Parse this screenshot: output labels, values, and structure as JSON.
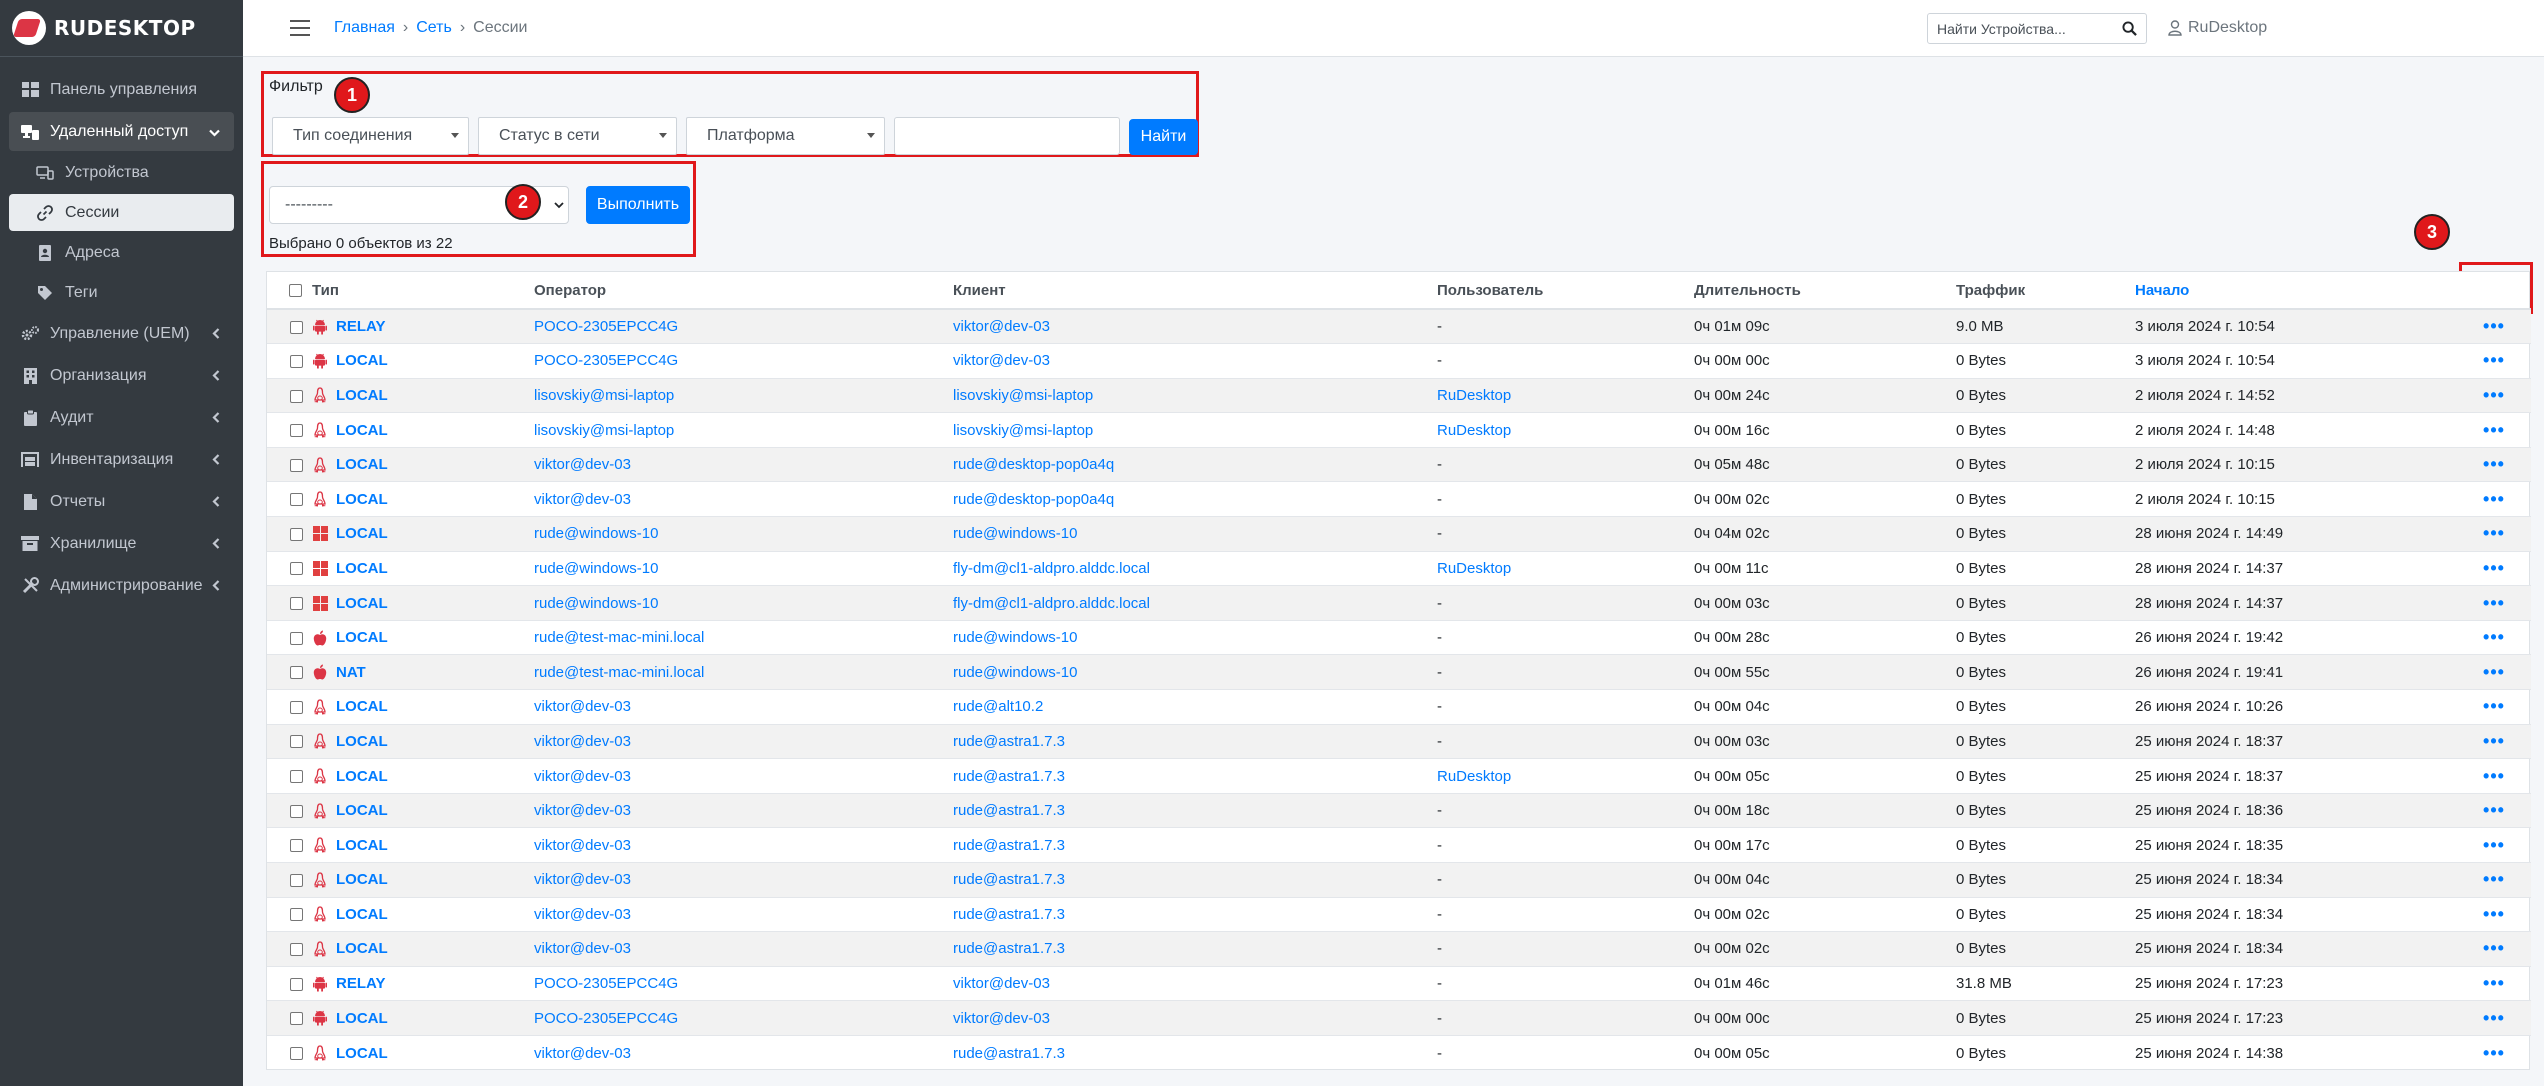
{
  "brand": {
    "name": "RUDESKTOP"
  },
  "sidebar": {
    "items": [
      {
        "label": "Панель управления",
        "icon": "dashboard-icon"
      },
      {
        "label": "Удаленный доступ",
        "icon": "remote-access-icon",
        "open": true
      },
      {
        "label": "Устройства",
        "icon": "devices-icon",
        "sub": true
      },
      {
        "label": "Сессии",
        "icon": "link-icon",
        "sub": true,
        "active": true
      },
      {
        "label": "Адреса",
        "icon": "address-book-icon",
        "sub": true
      },
      {
        "label": "Теги",
        "icon": "tag-icon",
        "sub": true
      },
      {
        "label": "Управление (UEM)",
        "icon": "gears-icon",
        "chevron": true
      },
      {
        "label": "Организация",
        "icon": "building-icon",
        "chevron": true
      },
      {
        "label": "Аудит",
        "icon": "clipboard-icon",
        "chevron": true
      },
      {
        "label": "Инвентаризация",
        "icon": "inventory-icon",
        "chevron": true
      },
      {
        "label": "Отчеты",
        "icon": "document-icon",
        "chevron": true
      },
      {
        "label": "Хранилище",
        "icon": "box-icon",
        "chevron": true
      },
      {
        "label": "Администрирование",
        "icon": "tools-icon",
        "chevron": true
      }
    ]
  },
  "breadcrumb": {
    "home": "Главная",
    "network": "Сеть",
    "current": "Сессии"
  },
  "search": {
    "placeholder": "Найти Устройства..."
  },
  "user": {
    "name": "RuDesktop"
  },
  "filter": {
    "label": "Фильтр",
    "connection_type": "Тип соединения",
    "online_status": "Статус в сети",
    "platform": "Платформа",
    "text_value": "",
    "find_button": "Найти"
  },
  "actions": {
    "select_value": "---------",
    "execute_button": "Выполнить",
    "selected_text": "Выбрано 0 объектов из 22"
  },
  "badges": {
    "one": "1",
    "two": "2",
    "three": "3"
  },
  "colors": {
    "accent": "#007bff",
    "annotation_red": "#e0181b",
    "android": "#dc3545",
    "windows": "#e04040",
    "linux": "#dc3545"
  },
  "table": {
    "headers": {
      "type": "Тип",
      "operator": "Оператор",
      "client": "Клиент",
      "user": "Пользователь",
      "duration": "Длительность",
      "traffic": "Траффик",
      "start": "Начало"
    },
    "rows": [
      {
        "os": "android",
        "type": "RELAY",
        "operator": "POCO-2305EPCC4G",
        "client": "viktor@dev-03",
        "user": "-",
        "duration": "0ч 01м 09с",
        "traffic": "9.0 MB",
        "start": "3 июля 2024 г. 10:54"
      },
      {
        "os": "android",
        "type": "LOCAL",
        "operator": "POCO-2305EPCC4G",
        "client": "viktor@dev-03",
        "user": "-",
        "duration": "0ч 00м 00с",
        "traffic": "0 Bytes",
        "start": "3 июля 2024 г. 10:54"
      },
      {
        "os": "linux",
        "type": "LOCAL",
        "operator": "lisovskiy@msi-laptop",
        "client": "lisovskiy@msi-laptop",
        "user": "RuDesktop",
        "duration": "0ч 00м 24с",
        "traffic": "0 Bytes",
        "start": "2 июля 2024 г. 14:52"
      },
      {
        "os": "linux",
        "type": "LOCAL",
        "operator": "lisovskiy@msi-laptop",
        "client": "lisovskiy@msi-laptop",
        "user": "RuDesktop",
        "duration": "0ч 00м 16с",
        "traffic": "0 Bytes",
        "start": "2 июля 2024 г. 14:48"
      },
      {
        "os": "linux",
        "type": "LOCAL",
        "operator": "viktor@dev-03",
        "client": "rude@desktop-pop0a4q",
        "user": "-",
        "duration": "0ч 05м 48с",
        "traffic": "0 Bytes",
        "start": "2 июля 2024 г. 10:15"
      },
      {
        "os": "linux",
        "type": "LOCAL",
        "operator": "viktor@dev-03",
        "client": "rude@desktop-pop0a4q",
        "user": "-",
        "duration": "0ч 00м 02с",
        "traffic": "0 Bytes",
        "start": "2 июля 2024 г. 10:15"
      },
      {
        "os": "windows",
        "type": "LOCAL",
        "operator": "rude@windows-10",
        "client": "rude@windows-10",
        "user": "-",
        "duration": "0ч 04м 02с",
        "traffic": "0 Bytes",
        "start": "28 июня 2024 г. 14:49"
      },
      {
        "os": "windows",
        "type": "LOCAL",
        "operator": "rude@windows-10",
        "client": "fly-dm@cl1-aldpro.alddc.local",
        "user": "RuDesktop",
        "duration": "0ч 00м 11с",
        "traffic": "0 Bytes",
        "start": "28 июня 2024 г. 14:37"
      },
      {
        "os": "windows",
        "type": "LOCAL",
        "operator": "rude@windows-10",
        "client": "fly-dm@cl1-aldpro.alddc.local",
        "user": "-",
        "duration": "0ч 00м 03с",
        "traffic": "0 Bytes",
        "start": "28 июня 2024 г. 14:37"
      },
      {
        "os": "apple",
        "type": "LOCAL",
        "operator": "rude@test-mac-mini.local",
        "client": "rude@windows-10",
        "user": "-",
        "duration": "0ч 00м 28с",
        "traffic": "0 Bytes",
        "start": "26 июня 2024 г. 19:42"
      },
      {
        "os": "apple",
        "type": "NAT",
        "operator": "rude@test-mac-mini.local",
        "client": "rude@windows-10",
        "user": "-",
        "duration": "0ч 00м 55с",
        "traffic": "0 Bytes",
        "start": "26 июня 2024 г. 19:41"
      },
      {
        "os": "linux",
        "type": "LOCAL",
        "operator": "viktor@dev-03",
        "client": "rude@alt10.2",
        "user": "-",
        "duration": "0ч 00м 04с",
        "traffic": "0 Bytes",
        "start": "26 июня 2024 г. 10:26"
      },
      {
        "os": "linux",
        "type": "LOCAL",
        "operator": "viktor@dev-03",
        "client": "rude@astra1.7.3",
        "user": "-",
        "duration": "0ч 00м 03с",
        "traffic": "0 Bytes",
        "start": "25 июня 2024 г. 18:37"
      },
      {
        "os": "linux",
        "type": "LOCAL",
        "operator": "viktor@dev-03",
        "client": "rude@astra1.7.3",
        "user": "RuDesktop",
        "duration": "0ч 00м 05с",
        "traffic": "0 Bytes",
        "start": "25 июня 2024 г. 18:37"
      },
      {
        "os": "linux",
        "type": "LOCAL",
        "operator": "viktor@dev-03",
        "client": "rude@astra1.7.3",
        "user": "-",
        "duration": "0ч 00м 18с",
        "traffic": "0 Bytes",
        "start": "25 июня 2024 г. 18:36"
      },
      {
        "os": "linux",
        "type": "LOCAL",
        "operator": "viktor@dev-03",
        "client": "rude@astra1.7.3",
        "user": "-",
        "duration": "0ч 00м 17с",
        "traffic": "0 Bytes",
        "start": "25 июня 2024 г. 18:35"
      },
      {
        "os": "linux",
        "type": "LOCAL",
        "operator": "viktor@dev-03",
        "client": "rude@astra1.7.3",
        "user": "-",
        "duration": "0ч 00м 04с",
        "traffic": "0 Bytes",
        "start": "25 июня 2024 г. 18:34"
      },
      {
        "os": "linux",
        "type": "LOCAL",
        "operator": "viktor@dev-03",
        "client": "rude@astra1.7.3",
        "user": "-",
        "duration": "0ч 00м 02с",
        "traffic": "0 Bytes",
        "start": "25 июня 2024 г. 18:34"
      },
      {
        "os": "linux",
        "type": "LOCAL",
        "operator": "viktor@dev-03",
        "client": "rude@astra1.7.3",
        "user": "-",
        "duration": "0ч 00м 02с",
        "traffic": "0 Bytes",
        "start": "25 июня 2024 г. 18:34"
      },
      {
        "os": "android",
        "type": "RELAY",
        "operator": "POCO-2305EPCC4G",
        "client": "viktor@dev-03",
        "user": "-",
        "duration": "0ч 01м 46с",
        "traffic": "31.8 MB",
        "start": "25 июня 2024 г. 17:23"
      },
      {
        "os": "android",
        "type": "LOCAL",
        "operator": "POCO-2305EPCC4G",
        "client": "viktor@dev-03",
        "user": "-",
        "duration": "0ч 00м 00с",
        "traffic": "0 Bytes",
        "start": "25 июня 2024 г. 17:23"
      },
      {
        "os": "linux",
        "type": "LOCAL",
        "operator": "viktor@dev-03",
        "client": "rude@astra1.7.3",
        "user": "-",
        "duration": "0ч 00м 05с",
        "traffic": "0 Bytes",
        "start": "25 июня 2024 г. 14:38"
      }
    ]
  }
}
